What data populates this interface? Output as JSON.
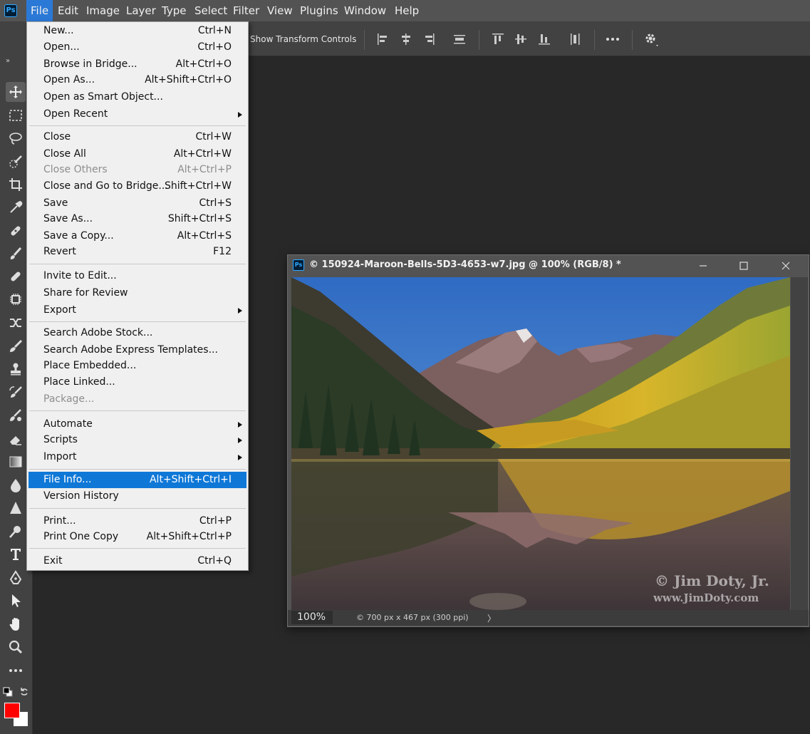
{
  "menubar": {
    "logo": "Ps",
    "items": [
      "File",
      "Edit",
      "Image",
      "Layer",
      "Type",
      "Select",
      "Filter",
      "View",
      "Plugins",
      "Window",
      "Help"
    ]
  },
  "options_bar": {
    "show_transform_controls": "Show Transform Controls"
  },
  "file_menu": {
    "items": [
      {
        "label": "New...",
        "shortcut": "Ctrl+N"
      },
      {
        "label": "Open...",
        "shortcut": "Ctrl+O"
      },
      {
        "label": "Browse in Bridge...",
        "shortcut": "Alt+Ctrl+O"
      },
      {
        "label": "Open As...",
        "shortcut": "Alt+Shift+Ctrl+O"
      },
      {
        "label": "Open as Smart Object...",
        "shortcut": ""
      },
      {
        "label": "Open Recent",
        "shortcut": "",
        "submenu": true
      },
      {
        "label": "Close",
        "shortcut": "Ctrl+W"
      },
      {
        "label": "Close All",
        "shortcut": "Alt+Ctrl+W"
      },
      {
        "label": "Close Others",
        "shortcut": "Alt+Ctrl+P",
        "disabled": true
      },
      {
        "label": "Close and Go to Bridge...",
        "shortcut": "Shift+Ctrl+W"
      },
      {
        "label": "Save",
        "shortcut": "Ctrl+S"
      },
      {
        "label": "Save As...",
        "shortcut": "Shift+Ctrl+S"
      },
      {
        "label": "Save a Copy...",
        "shortcut": "Alt+Ctrl+S"
      },
      {
        "label": "Revert",
        "shortcut": "F12"
      },
      {
        "label": "Invite to Edit...",
        "shortcut": ""
      },
      {
        "label": "Share for Review",
        "shortcut": ""
      },
      {
        "label": "Export",
        "shortcut": "",
        "submenu": true
      },
      {
        "label": "Search Adobe Stock...",
        "shortcut": ""
      },
      {
        "label": "Search Adobe Express Templates...",
        "shortcut": ""
      },
      {
        "label": "Place Embedded...",
        "shortcut": ""
      },
      {
        "label": "Place Linked...",
        "shortcut": ""
      },
      {
        "label": "Package...",
        "shortcut": "",
        "disabled": true
      },
      {
        "label": "Automate",
        "shortcut": "",
        "submenu": true
      },
      {
        "label": "Scripts",
        "shortcut": "",
        "submenu": true
      },
      {
        "label": "Import",
        "shortcut": "",
        "submenu": true
      },
      {
        "label": "File Info...",
        "shortcut": "Alt+Shift+Ctrl+I",
        "highlighted": true
      },
      {
        "label": "Version History",
        "shortcut": ""
      },
      {
        "label": "Print...",
        "shortcut": "Ctrl+P"
      },
      {
        "label": "Print One Copy",
        "shortcut": "Alt+Shift+Ctrl+P"
      },
      {
        "label": "Exit",
        "shortcut": "Ctrl+Q"
      }
    ]
  },
  "document": {
    "title": "© 150924-Maroon-Bells-5D3-4653-w7.jpg @ 100% (RGB/8) *",
    "zoom": "100%",
    "info": "© 700 px x 467 px (300 ppi)",
    "watermark_line1": "© Jim Doty, Jr.",
    "watermark_line2": "www.JimDoty.com"
  },
  "colors": {
    "foreground": "#ff0000",
    "background": "#ffffff",
    "highlight": "#0f78d7"
  }
}
